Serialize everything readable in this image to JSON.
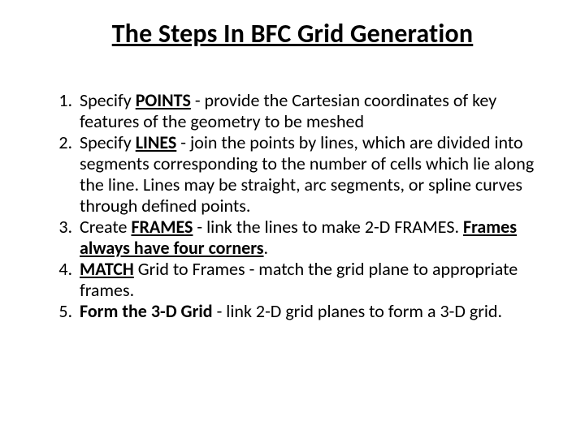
{
  "title": "The Steps In BFC Grid Generation",
  "steps": {
    "s1": {
      "lead": "Specify ",
      "kw": "POINTS",
      "rest": " - provide the Cartesian coordinates of key features of the geometry to be meshed"
    },
    "s2": {
      "lead": "Specify ",
      "kw": "LINES",
      "rest": " - join the points by lines, which are divided into segments corresponding to the number of cells which lie along the line. Lines may be straight, arc segments, or spline curves through defined points."
    },
    "s3": {
      "lead": "Create ",
      "kw": "FRAMES",
      "mid": " - link the lines to make 2-D FRAMES. ",
      "note": "Frames always have four corners",
      "tail": "."
    },
    "s4": {
      "kw": "MATCH",
      "rest": " Grid to Frames - match the grid plane to appropriate frames."
    },
    "s5": {
      "kw": "Form the 3-D Grid",
      "rest": " - link 2-D grid planes to form a 3-D grid."
    }
  }
}
